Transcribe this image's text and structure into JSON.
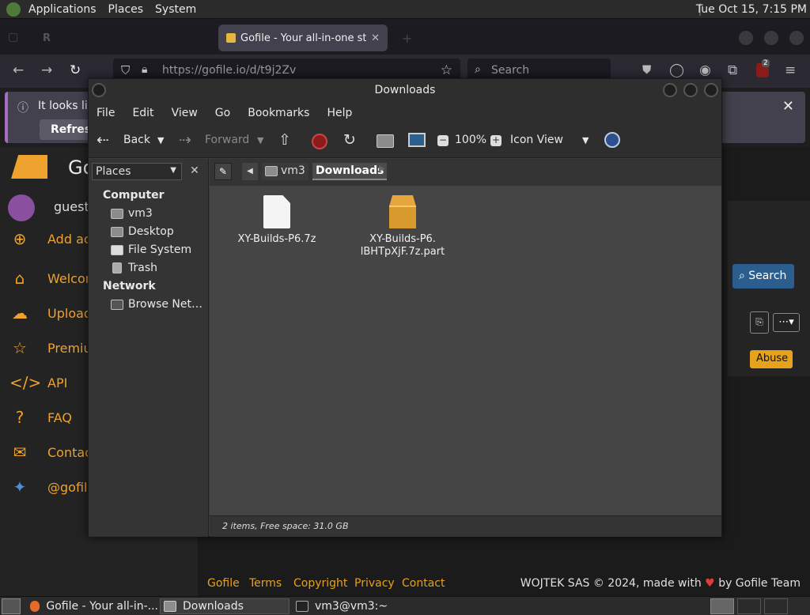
{
  "top_panel": {
    "menus": [
      "Applications",
      "Places",
      "System"
    ],
    "clock": "Tue Oct 15, 7:15 PM"
  },
  "browser": {
    "tabs": [
      {
        "title": "Gofile - Your all-in-one sto",
        "active": true
      }
    ],
    "url": "https://gofile.io/d/t9j2Zv",
    "search_placeholder": "Search",
    "extension_badge": "2",
    "notification": {
      "message": "It looks like",
      "button": "Refresh"
    }
  },
  "gofile": {
    "logo_text": "Go",
    "user": "guest",
    "nav": [
      {
        "icon": "add-user-icon",
        "label": "Add ac"
      },
      {
        "icon": "home-icon",
        "label": "Welcon"
      },
      {
        "icon": "upload-icon",
        "label": "Upload"
      },
      {
        "icon": "star-icon",
        "label": "Premiu"
      },
      {
        "icon": "code-icon",
        "label": "API"
      },
      {
        "icon": "question-icon",
        "label": "FAQ"
      },
      {
        "icon": "envelope-icon",
        "label": "Contac"
      },
      {
        "icon": "twitter-icon",
        "label": "@gofile"
      }
    ],
    "search_button": "Search",
    "abuse_button": "Abuse",
    "footer_links": [
      "Gofile",
      "Terms",
      "Copyright",
      "Privacy",
      "Contact"
    ],
    "copyright_pre": "WOJTEK SAS © 2024, made with",
    "copyright_post": "by Gofile Team",
    "accent": "#e6a21a"
  },
  "file_manager": {
    "title": "Downloads",
    "menu": [
      "File",
      "Edit",
      "View",
      "Go",
      "Bookmarks",
      "Help"
    ],
    "toolbar": {
      "back": "Back",
      "forward": "Forward",
      "zoom": "100%",
      "view_mode": "Icon View"
    },
    "sidebar": {
      "selector": "Places",
      "sections": [
        {
          "heading": "Computer",
          "items": [
            "vm3",
            "Desktop",
            "File System",
            "Trash"
          ]
        },
        {
          "heading": "Network",
          "items": [
            "Browse Net…"
          ]
        }
      ]
    },
    "path": [
      "vm3",
      "Downloads"
    ],
    "files": [
      {
        "name_line1": "XY-Builds-P6.7z",
        "name_line2": "",
        "icon": "document-icon"
      },
      {
        "name_line1": "XY-Builds-P6.",
        "name_line2": "lBHTpXjF.7z.part",
        "icon": "package-icon"
      }
    ],
    "status": "2 items, Free space: 31.0 GB"
  },
  "taskbar": {
    "tasks": [
      "Gofile - Your all-in-...",
      "Downloads",
      "vm3@vm3:~"
    ]
  }
}
